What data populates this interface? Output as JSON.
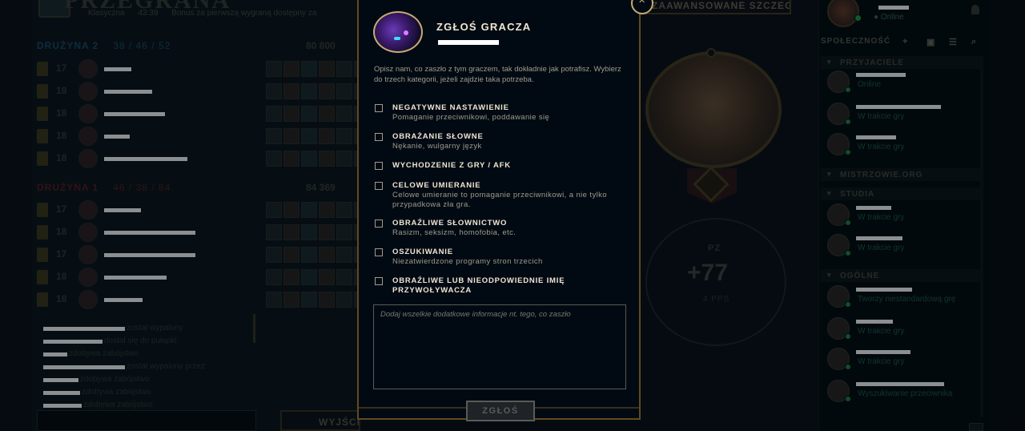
{
  "background": {
    "title": "PRZEGRANA",
    "subline": [
      "Klasyczna",
      "43:39",
      "Bonus za pierwszą wygraną dostępny za"
    ],
    "teams": [
      {
        "name": "DRUŻYNA 2",
        "stats": "38 / 46 / 52",
        "gold": "80 800",
        "players": [
          {
            "level": "17",
            "name_width": 34
          },
          {
            "level": "18",
            "name_width": 60
          },
          {
            "level": "18",
            "name_width": 76
          },
          {
            "level": "18",
            "name_width": 32
          },
          {
            "level": "18",
            "name_width": 104
          }
        ]
      },
      {
        "name": "DRUŻYNA 1",
        "stats": "46 / 38 / 84",
        "gold": "84 369",
        "players": [
          {
            "level": "17",
            "name_width": 46
          },
          {
            "level": "18",
            "name_width": 114
          },
          {
            "level": "17",
            "name_width": 114
          },
          {
            "level": "18",
            "name_width": 78
          },
          {
            "level": "18",
            "name_width": 48
          }
        ]
      }
    ],
    "chat": [
      {
        "name_width": 102,
        "text": "został wypalony"
      },
      {
        "name_width": 74,
        "text": "dostał się do pułapki"
      },
      {
        "name_width": 30,
        "text": "zdobywa zabójstwo"
      },
      {
        "name_width": 102,
        "text": "został wypalony przez"
      },
      {
        "name_width": 44,
        "text": "zdobywa zabójstwo"
      },
      {
        "name_width": 46,
        "text": "zdobywa zabójstwo"
      },
      {
        "name_width": 48,
        "text": "zdobywa zabójstwo"
      }
    ],
    "exit_button": "WYJŚCIE",
    "advanced_button": "ZAAWANSOWANE SZCZEGÓŁY",
    "lp": {
      "label": "PZ",
      "value": "+77",
      "sub": "4 PPS"
    }
  },
  "social": {
    "status": "Online",
    "label": "SPOŁECZNOŚĆ",
    "groups": [
      {
        "name": "PRZYJACIELE",
        "friends": [
          {
            "name_width": 62,
            "status": "Online"
          },
          {
            "name_width": 106,
            "status": "W trakcie gry"
          },
          {
            "name_width": 50,
            "status": "W trakcie gry"
          }
        ]
      },
      {
        "name": "MISTRZOWIE.ORG",
        "friends": []
      },
      {
        "name": "STUDIA",
        "friends": [
          {
            "name_width": 44,
            "status": "W trakcie gry"
          },
          {
            "name_width": 58,
            "status": "W trakcie gry"
          }
        ]
      },
      {
        "name": "OGÓLNE",
        "friends": [
          {
            "name_width": 70,
            "status": "Tworzy niestandardową grę"
          },
          {
            "name_width": 46,
            "status": "W trakcie gry"
          },
          {
            "name_width": 68,
            "status": "W trakcie gry"
          },
          {
            "name_width": 110,
            "status": "Wyszukiwanie przeciwnika"
          }
        ]
      }
    ]
  },
  "modal": {
    "title": "ZGŁOŚ GRACZA",
    "description": "Opisz nam, co zaszło z tym graczem, tak dokładnie jak potrafisz. Wybierz do trzech kategorii, jeżeli zajdzie taka potrzeba.",
    "categories": [
      {
        "title": "NEGATYWNE NASTAWIENIE",
        "desc": "Pomaganie przeciwnikowi, poddawanie się"
      },
      {
        "title": "OBRAŻANIE SŁOWNE",
        "desc": "Nękanie, wulgarny język"
      },
      {
        "title": "WYCHODZENIE Z GRY / AFK",
        "desc": ""
      },
      {
        "title": "CELOWE UMIERANIE",
        "desc": "Celowe umieranie to pomaganie przeciwnikowi, a nie tylko przypadkowa zła gra."
      },
      {
        "title": "OBRAŹLIWE SŁOWNICTWO",
        "desc": "Rasizm, seksizm, homofobia, etc."
      },
      {
        "title": "OSZUKIWANIE",
        "desc": "Niezatwierdzone programy stron trzecich"
      },
      {
        "title": "OBRAŹLIWE LUB NIEODPOWIEDNIE IMIĘ PRZYWOŁYWACZA",
        "desc": ""
      }
    ],
    "placeholder": "Dodaj wszelkie dodatkowe informacje nt. tego, co zaszło",
    "submit": "ZGŁOŚ"
  }
}
